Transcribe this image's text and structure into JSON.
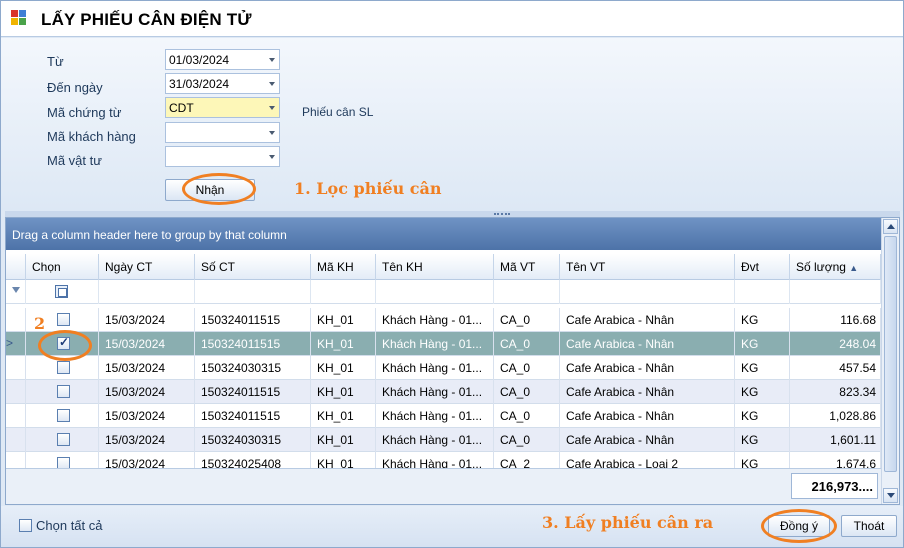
{
  "window": {
    "title": "LẤY PHIẾU CÂN ĐIỆN TỬ"
  },
  "filters": {
    "from_label": "Từ",
    "from_value": "01/03/2024",
    "to_label": "Đến ngày",
    "to_value": "31/03/2024",
    "doc_code_label": "Mã chứng từ",
    "doc_code_value": "CDT",
    "doc_code_desc": "Phiếu cân SL",
    "customer_label": "Mã khách hàng",
    "customer_value": "",
    "material_label": "Mã vật tư",
    "material_value": "",
    "submit_label": "Nhận"
  },
  "annotations": {
    "step1": "1. Lọc phiếu cân",
    "step2": "2",
    "step3": "3. Lấy phiếu cân ra"
  },
  "colors": {
    "annotation": "#f07f22",
    "selected_row": "#8aaeb0",
    "group_panel": "#5a7fb4"
  },
  "grid": {
    "group_hint": "Drag a column header here to group by that column",
    "columns": [
      "Chọn",
      "Ngày CT",
      "Số CT",
      "Mã KH",
      "Tên KH",
      "Mã VT",
      "Tên VT",
      "Đvt",
      "Số lượng"
    ],
    "sort_indicator": "▲",
    "rows": [
      {
        "checked": false,
        "selected": false,
        "date": "15/03/2024",
        "doc_no": "150324011515",
        "cust_code": "KH_01",
        "cust_name": "Khách Hàng  - 01...",
        "mat_code": "CA_0",
        "mat_name": "Cafe Arabica - Nhân",
        "unit": "KG",
        "qty": "116.68"
      },
      {
        "checked": true,
        "selected": true,
        "date": "15/03/2024",
        "doc_no": "150324011515",
        "cust_code": "KH_01",
        "cust_name": "Khách Hàng  - 01...",
        "mat_code": "CA_0",
        "mat_name": "Cafe Arabica - Nhân",
        "unit": "KG",
        "qty": "248.04"
      },
      {
        "checked": false,
        "selected": false,
        "date": "15/03/2024",
        "doc_no": "150324030315",
        "cust_code": "KH_01",
        "cust_name": "Khách Hàng  - 01...",
        "mat_code": "CA_0",
        "mat_name": "Cafe Arabica - Nhân",
        "unit": "KG",
        "qty": "457.54"
      },
      {
        "checked": false,
        "selected": false,
        "date": "15/03/2024",
        "doc_no": "150324011515",
        "cust_code": "KH_01",
        "cust_name": "Khách Hàng  - 01...",
        "mat_code": "CA_0",
        "mat_name": "Cafe Arabica - Nhân",
        "unit": "KG",
        "qty": "823.34"
      },
      {
        "checked": false,
        "selected": false,
        "date": "15/03/2024",
        "doc_no": "150324011515",
        "cust_code": "KH_01",
        "cust_name": "Khách Hàng  - 01...",
        "mat_code": "CA_0",
        "mat_name": "Cafe Arabica - Nhân",
        "unit": "KG",
        "qty": "1,028.86"
      },
      {
        "checked": false,
        "selected": false,
        "date": "15/03/2024",
        "doc_no": "150324030315",
        "cust_code": "KH_01",
        "cust_name": "Khách Hàng  - 01...",
        "mat_code": "CA_0",
        "mat_name": "Cafe Arabica - Nhân",
        "unit": "KG",
        "qty": "1,601.11"
      },
      {
        "checked": false,
        "selected": false,
        "date": "15/03/2024",
        "doc_no": "150324025408",
        "cust_code": "KH_01",
        "cust_name": "Khách Hàng  - 01...",
        "mat_code": "CA_2",
        "mat_name": "Cafe Arabica - Loại 2",
        "unit": "KG",
        "qty": "1,674.6"
      }
    ],
    "total_qty": "216,973...."
  },
  "bottom": {
    "select_all_label": "Chọn tất cả",
    "ok_label": "Đồng ý",
    "exit_label": "Thoát"
  }
}
